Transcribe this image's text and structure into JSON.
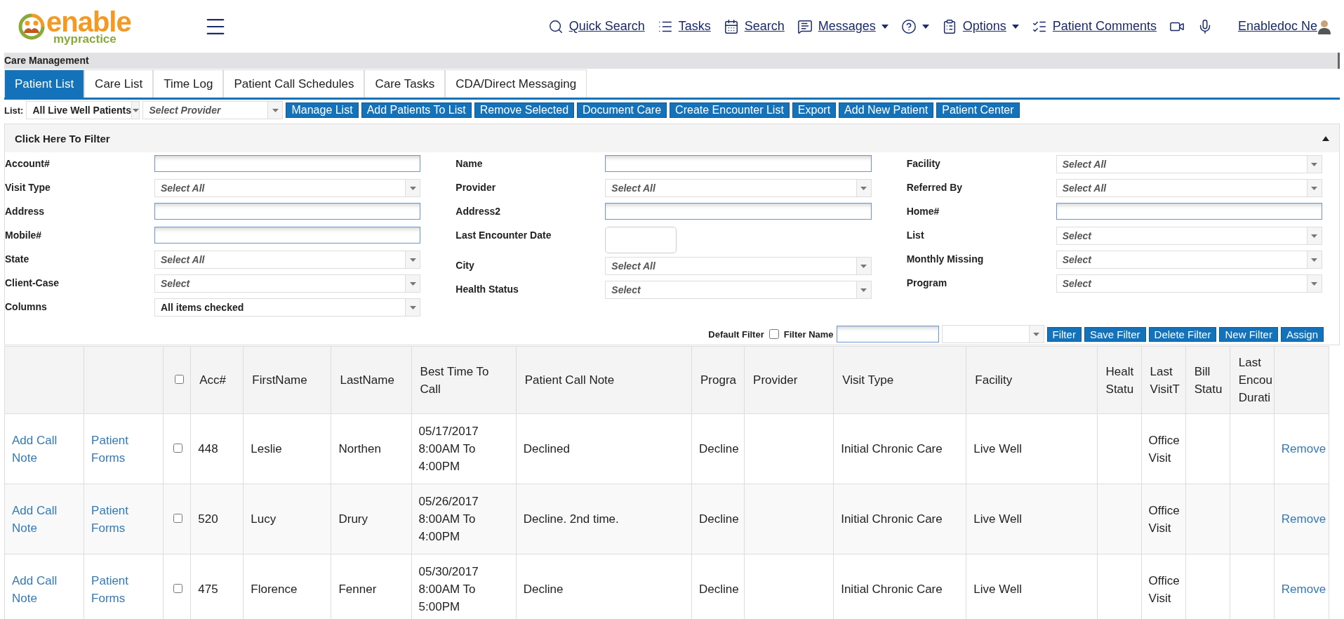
{
  "logo": {
    "word": "enable",
    "tagline": "mypractice"
  },
  "nav": [
    {
      "kind": "search",
      "label": "Quick Search",
      "dropdown": false
    },
    {
      "kind": "tasks",
      "label": "Tasks",
      "dropdown": false
    },
    {
      "kind": "calendar",
      "label": "Search",
      "dropdown": false
    },
    {
      "kind": "messages",
      "label": "Messages",
      "dropdown": true
    },
    {
      "kind": "help",
      "dropdown": true
    },
    {
      "kind": "options",
      "label": "Options",
      "dropdown": true
    },
    {
      "kind": "comments",
      "label": "Patient Comments",
      "dropdown": false
    },
    {
      "kind": "video",
      "dropdown": false
    },
    {
      "kind": "mic",
      "dropdown": false
    }
  ],
  "user": {
    "name": "Enabledoc Ne"
  },
  "section_title": "Care Management",
  "tabs": [
    {
      "label": "Patient List",
      "selected": true
    },
    {
      "label": "Care List",
      "selected": false
    },
    {
      "label": "Time Log",
      "selected": false
    },
    {
      "label": "Patient Call Schedules",
      "selected": false
    },
    {
      "label": "Care Tasks",
      "selected": false
    },
    {
      "label": "CDA/Direct Messaging",
      "selected": false
    }
  ],
  "toolbar": {
    "list_label": "List:",
    "list_value": "All Live Well Patients",
    "provider_placeholder": "Select Provider",
    "actions": [
      "Manage List",
      "Add Patients To List",
      "Remove Selected",
      "Document Care",
      "Create Encounter List",
      "Export",
      "Add New Patient",
      "Patient Center"
    ]
  },
  "filter": {
    "title": "Click Here To Filter",
    "expanded": true,
    "columns": [
      [
        {
          "label": "Account#",
          "kind": "text"
        },
        {
          "label": "Visit Type",
          "kind": "select",
          "placeholder": "Select All"
        },
        {
          "label": "Address",
          "kind": "text"
        },
        {
          "label": "Mobile#",
          "kind": "text"
        },
        {
          "label": "State",
          "kind": "select",
          "placeholder": "Select All"
        },
        {
          "label": "Client-Case",
          "kind": "select",
          "placeholder": "Select"
        },
        {
          "label": "Columns",
          "kind": "select",
          "value": "All items checked"
        }
      ],
      [
        {
          "label": "Name",
          "kind": "text"
        },
        {
          "label": "Provider",
          "kind": "select",
          "placeholder": "Select All"
        },
        {
          "label": "Address2",
          "kind": "text"
        },
        {
          "label": "Last Encounter Date",
          "kind": "date"
        },
        {
          "label": "City",
          "kind": "select",
          "placeholder": "Select All"
        },
        {
          "label": "Health Status",
          "kind": "select",
          "placeholder": "Select"
        }
      ],
      [
        {
          "label": "Facility",
          "kind": "select",
          "placeholder": "Select All"
        },
        {
          "label": "Referred By",
          "kind": "select",
          "placeholder": "Select All"
        },
        {
          "label": "Home#",
          "kind": "text"
        },
        {
          "label": "List",
          "kind": "select",
          "placeholder": "Select"
        },
        {
          "label": "Monthly Missing",
          "kind": "select",
          "placeholder": "Select"
        },
        {
          "label": "Program",
          "kind": "select",
          "placeholder": "Select"
        }
      ]
    ],
    "default_filter_label": "Default Filter",
    "default_filter_checked": false,
    "filter_name_label": "Filter Name",
    "buttons": [
      "Filter",
      "Save Filter",
      "Delete Filter",
      "New Filter",
      "Assign"
    ]
  },
  "table": {
    "select_all_checked": false,
    "columns": [
      "Acc#",
      "FirstName",
      "LastName",
      "Best Time To Call",
      "Patient Call Note",
      "Progra",
      "Provider",
      "Visit Type",
      "Facility",
      "Healt Statu",
      "Last VisitT",
      "Bill Statu",
      "Last Encou Durati"
    ],
    "rows": [
      {
        "add_note": "Add Call Note",
        "forms": "Patient Forms",
        "checked": false,
        "cells": [
          "448",
          "Leslie",
          "Northen",
          "05/17/2017 8:00AM To 4:00PM",
          "Declined",
          "Decline",
          null,
          "Initial Chronic Care",
          "Live Well",
          null,
          "Office Visit",
          null,
          null
        ],
        "remove": "Remove"
      },
      {
        "add_note": "Add Call Note",
        "forms": "Patient Forms",
        "checked": false,
        "cells": [
          "520",
          "Lucy",
          "Drury",
          "05/26/2017 8:00AM To 4:00PM",
          "Decline. 2nd time.",
          "Decline",
          null,
          "Initial Chronic Care",
          "Live Well",
          null,
          "Office Visit",
          null,
          null
        ],
        "remove": "Remove"
      },
      {
        "add_note": "Add Call Note",
        "forms": "Patient Forms",
        "checked": false,
        "cells": [
          "475",
          "Florence",
          "Fenner",
          "05/30/2017 8:00AM To 5:00PM",
          "Decline",
          "Decline",
          null,
          "Initial Chronic Care",
          "Live Well",
          null,
          "Office Visit",
          null,
          null
        ],
        "remove": "Remove"
      }
    ]
  }
}
